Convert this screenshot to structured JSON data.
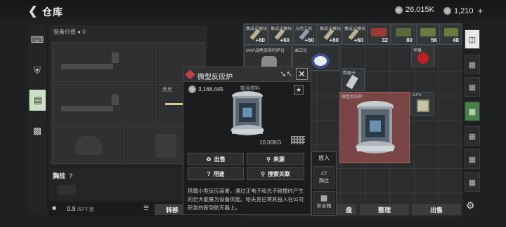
{
  "header": {
    "back_icon": "back-arrow-icon",
    "title": "仓库",
    "coin_amount": "26,015K",
    "gem_amount": "1,210"
  },
  "left_panel": {
    "equip_value_label": "装备价值",
    "equip_value": "0",
    "chest_label": "胸挂",
    "chest_hint": "?",
    "capacity": "0.9",
    "capacity_max": "/87千克"
  },
  "left_categories": [
    "gun-icon",
    "backpack-icon",
    "clipboard-icon",
    "briefcase-icon"
  ],
  "bottom_buttons": {
    "transfer": "转移",
    "sort_prev": "盘",
    "sort": "整理",
    "sell": "出售"
  },
  "grid_items": [
    {
      "name": "集成式模块",
      "count": "60"
    },
    {
      "name": "集成式模块",
      "count": "60"
    },
    {
      "name": "万用工具",
      "count": "60"
    },
    {
      "name": "集成式模块",
      "count": "60"
    },
    {
      "name": "集成式模块",
      "count": "60"
    },
    {
      "name": "",
      "count": "32"
    },
    {
      "name": "",
      "count": "80"
    },
    {
      "name": "",
      "count": "56"
    },
    {
      "name": "",
      "count": "48"
    },
    {
      "name": "MAP战略资质阿萨谷",
      "count": ""
    },
    {
      "name": "血压仪",
      "count": ""
    },
    {
      "name": "苹果",
      "count": ""
    },
    {
      "name": "数据卡",
      "count": ""
    },
    {
      "name": "微型反应炉",
      "count": ""
    },
    {
      "name": "CPU",
      "count": ""
    }
  ],
  "popup": {
    "title": "微型反应炉",
    "value": "3,168,445",
    "category": "能源燃料",
    "weight": "10.00KG",
    "actions": {
      "sell": "出售",
      "source": "来源",
      "use": "用途",
      "search": "搜索关联"
    },
    "description": "搭载小型反应装置，通过正电子和光子碰撞时产生的巨大能量为设备供能。哈夫克已将其投入在公司研发的新型航天器上。"
  },
  "put_in": {
    "label": "放入",
    "chest": "胸挂",
    "safebox": "安全箱"
  },
  "colors": {
    "accent": "#46804a",
    "reactor_border": "#c0404a"
  }
}
